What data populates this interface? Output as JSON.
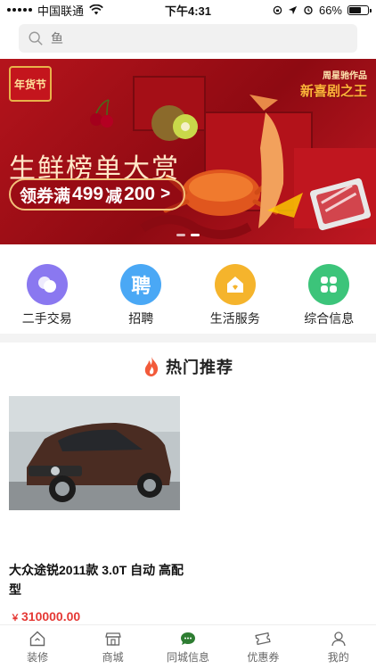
{
  "status_bar": {
    "carrier": "中国联通",
    "time": "下午4:31",
    "battery": "66%",
    "battery_level": 0.66
  },
  "search": {
    "placeholder": "鱼"
  },
  "banner": {
    "badge": "年货节",
    "headline": "生鲜榜单大赏",
    "coupon_prefix": "领券满",
    "coupon_amount1": "499",
    "coupon_mid": "减",
    "coupon_amount2": "200",
    "coupon_arrow": ">",
    "corner_small": "周星驰作品",
    "corner_big": "新喜剧之王"
  },
  "categories": [
    {
      "label": "二手交易",
      "icon": "second-hand-icon",
      "color": "#8a78f0"
    },
    {
      "label": "招聘",
      "icon": "recruit-icon",
      "glyph": "聘",
      "color": "#4aa8f5"
    },
    {
      "label": "生活服务",
      "icon": "home-service-icon",
      "color": "#f5b42c"
    },
    {
      "label": "综合信息",
      "icon": "grid-info-icon",
      "color": "#3cc47a"
    }
  ],
  "hot": {
    "title": "热门推荐"
  },
  "listing": {
    "title": "大众途锐2011款 3.0T 自动 高配型",
    "currency": "￥",
    "price": "310000.00"
  },
  "tabbar": [
    {
      "label": "装修",
      "icon": "house-icon"
    },
    {
      "label": "商城",
      "icon": "shop-icon"
    },
    {
      "label": "同城信息",
      "icon": "chat-bubble-icon"
    },
    {
      "label": "优惠券",
      "icon": "coupon-icon"
    },
    {
      "label": "我的",
      "icon": "user-icon"
    }
  ],
  "colors": {
    "accent_red": "#e53935",
    "banner_red": "#b5141c"
  }
}
